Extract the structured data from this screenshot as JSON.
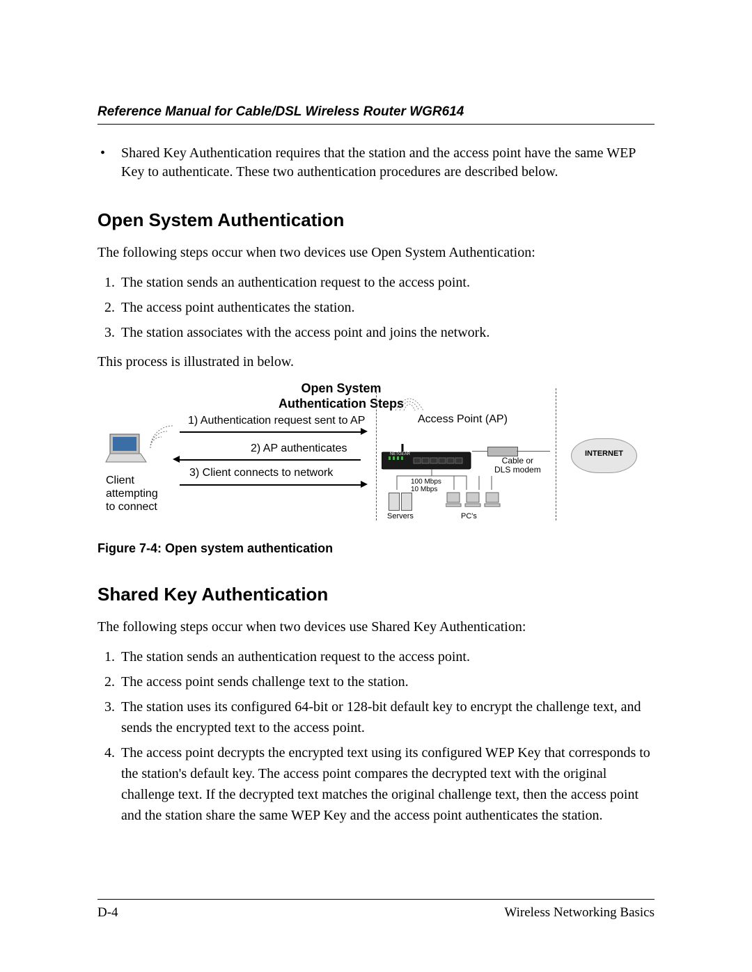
{
  "header": {
    "title": "Reference Manual for Cable/DSL Wireless Router WGR614"
  },
  "intro_bullet": "Shared Key Authentication requires that the station and the access point have the same WEP Key to authenticate. These two authentication procedures are described below.",
  "section1": {
    "heading": "Open System Authentication",
    "lead": "The following steps occur when two devices use Open System Authentication:",
    "steps": [
      "The station sends an authentication request to the access point.",
      "The access point authenticates the station.",
      "The station associates with the access point and joins the network."
    ],
    "tail": "This process is illustrated in below."
  },
  "diagram": {
    "title_line1": "Open System",
    "title_line2": "Authentication Steps",
    "step1": "1) Authentication request sent to AP",
    "step2": "2) AP authenticates",
    "step3": "3) Client connects to network",
    "client_label_l1": "Client",
    "client_label_l2": "attempting",
    "client_label_l3": "to connect",
    "ap_label": "Access Point (AP)",
    "modem_label_l1": "Cable or",
    "modem_label_l2": "DLS modem",
    "servers_label": "Servers",
    "pcs_label": "PC's",
    "bw_label_l1": "100 Mbps",
    "bw_label_l2": "10 Mbps",
    "internet_label": "INTERNET"
  },
  "figure_caption": "Figure 7-4:  Open system authentication",
  "section2": {
    "heading": "Shared Key Authentication",
    "lead": "The following steps occur when two devices use Shared Key Authentication:",
    "steps": [
      "The station sends an authentication request to the access point.",
      "The access point sends challenge text to the station.",
      "The station uses its configured 64-bit or 128-bit default key to encrypt the challenge text, and sends the encrypted text to the access point.",
      "The access point decrypts the encrypted text using its configured WEP Key that corresponds to the station's default key. The access point compares the decrypted text with the original challenge text. If the decrypted text matches the original challenge text, then the access point and the station share the same WEP Key and the access point authenticates the station."
    ]
  },
  "footer": {
    "page_number": "D-4",
    "section_title": "Wireless Networking Basics"
  }
}
